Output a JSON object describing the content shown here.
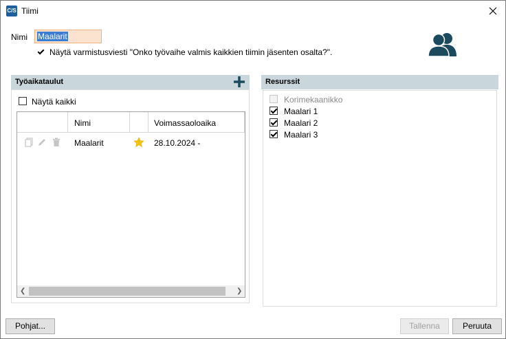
{
  "window": {
    "title": "Tiimi",
    "app_icon_text": "C/S"
  },
  "form": {
    "name_label": "Nimi",
    "name_value": "Maalarit",
    "confirm_checkbox_checked": true,
    "confirm_checkbox_label": "Näytä varmistusviesti \"Onko työvaihe valmis kaikkien tiimin jäsenten osalta?\"."
  },
  "schedules": {
    "header": "Työaikataulut",
    "show_all_label": "Näytä kaikki",
    "show_all_checked": false,
    "columns": [
      "Nimi",
      "Voimassaoloaika"
    ],
    "rows": [
      {
        "name": "Maalarit",
        "valid_from": "28.10.2024 -",
        "favorite": true
      }
    ]
  },
  "resources": {
    "header": "Resurssit",
    "items": [
      {
        "label": "Korimekaanikko",
        "checked": false,
        "enabled": false
      },
      {
        "label": "Maalari 1",
        "checked": true,
        "enabled": true
      },
      {
        "label": "Maalari 2",
        "checked": true,
        "enabled": true
      },
      {
        "label": "Maalari 3",
        "checked": true,
        "enabled": true
      }
    ]
  },
  "footer": {
    "templates_button": "Pohjat...",
    "save_button": "Tallenna",
    "cancel_button": "Peruuta"
  },
  "colors": {
    "accent": "#1b4a5e",
    "section_header_bg": "#c9d6dc",
    "star": "#f5c400"
  }
}
